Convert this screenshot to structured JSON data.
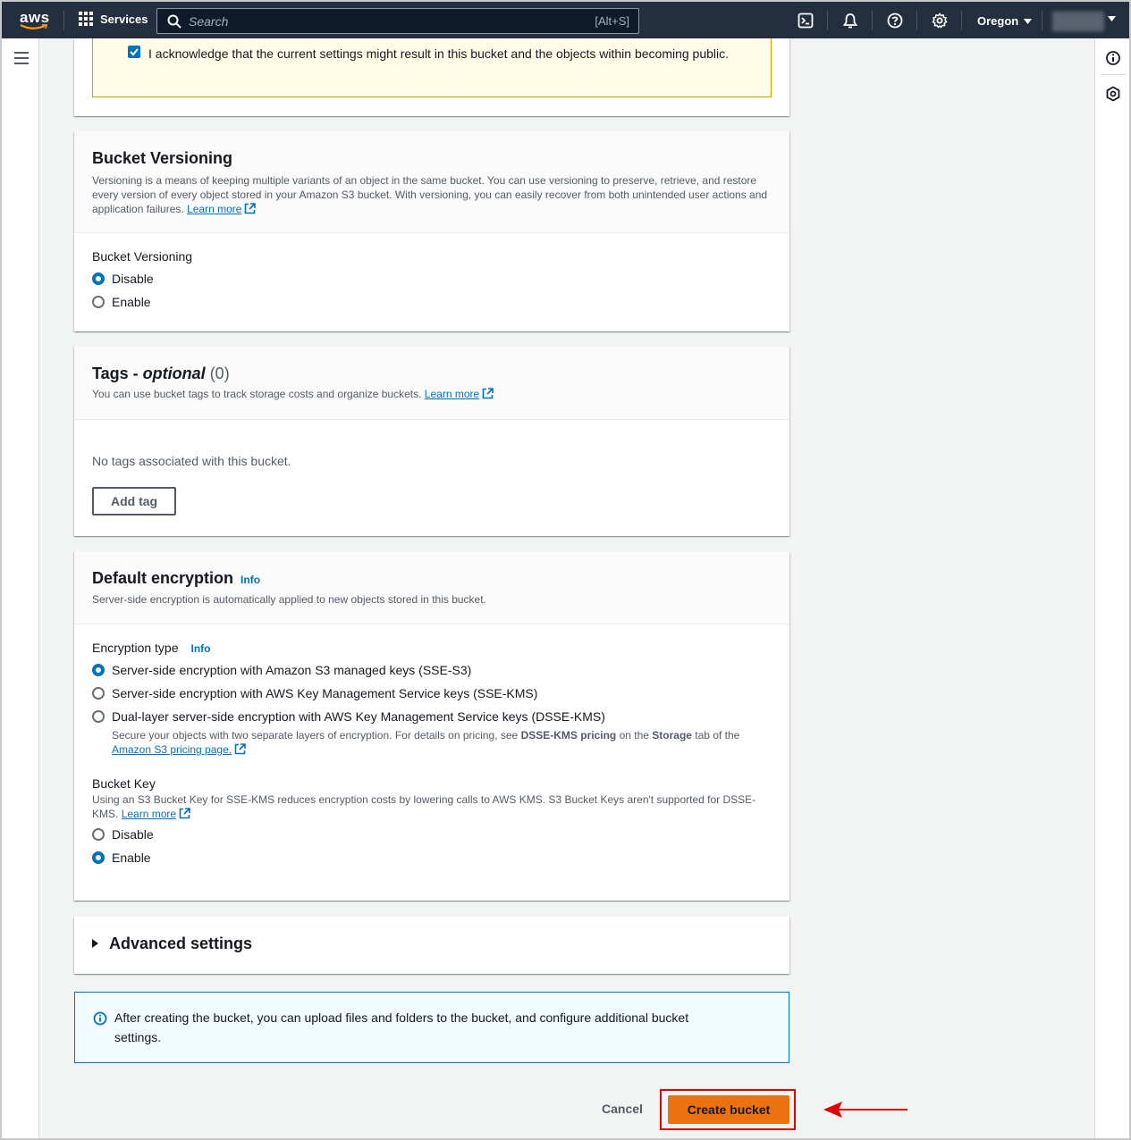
{
  "topnav": {
    "logo_text": "aws",
    "services_label": "Services",
    "search_placeholder": "Search",
    "search_shortcut": "[Alt+S]",
    "region": "Oregon"
  },
  "ack": {
    "text": "I acknowledge that the current settings might result in this bucket and the objects within becoming public.",
    "checked": true
  },
  "versioning": {
    "title": "Bucket Versioning",
    "description": "Versioning is a means of keeping multiple variants of an object in the same bucket. You can use versioning to preserve, retrieve, and restore every version of every object stored in your Amazon S3 bucket. With versioning, you can easily recover from both unintended user actions and application failures.",
    "learn_more": "Learn more",
    "field_label": "Bucket Versioning",
    "options": [
      "Disable",
      "Enable"
    ],
    "selected": "Disable"
  },
  "tags": {
    "title_main": "Tags - ",
    "title_italic": "optional",
    "count": "(0)",
    "description": "You can use bucket tags to track storage costs and organize buckets.",
    "learn_more": "Learn more",
    "empty_text": "No tags associated with this bucket.",
    "add_button": "Add tag"
  },
  "encryption": {
    "title": "Default encryption",
    "info": "Info",
    "description": "Server-side encryption is automatically applied to new objects stored in this bucket.",
    "type_label": "Encryption type",
    "type_info": "Info",
    "options": [
      "Server-side encryption with Amazon S3 managed keys (SSE-S3)",
      "Server-side encryption with AWS Key Management Service keys (SSE-KMS)",
      "Dual-layer server-side encryption with AWS Key Management Service keys (DSSE-KMS)"
    ],
    "selected_index": 0,
    "dsse_desc_1": "Secure your objects with two separate layers of encryption. For details on pricing, see ",
    "dsse_desc_bold1": "DSSE-KMS pricing",
    "dsse_desc_2": " on the ",
    "dsse_desc_bold2": "Storage",
    "dsse_desc_3": " tab of the ",
    "dsse_pricing_link": "Amazon S3 pricing page.",
    "bucket_key_label": "Bucket Key",
    "bucket_key_desc": "Using an S3 Bucket Key for SSE-KMS reduces encryption costs by lowering calls to AWS KMS. S3 Bucket Keys aren't supported for DSSE-KMS.",
    "bucket_key_learn_more": "Learn more",
    "bucket_key_options": [
      "Disable",
      "Enable"
    ],
    "bucket_key_selected": "Enable"
  },
  "advanced": {
    "title": "Advanced settings"
  },
  "info_alert": {
    "text": "After creating the bucket, you can upload files and folders to the bucket, and configure additional bucket settings."
  },
  "actions": {
    "cancel": "Cancel",
    "create": "Create bucket"
  },
  "colors": {
    "nav_bg": "#232f3e",
    "primary": "#ec7211",
    "link": "#0073bb",
    "highlight": "#e00000"
  }
}
